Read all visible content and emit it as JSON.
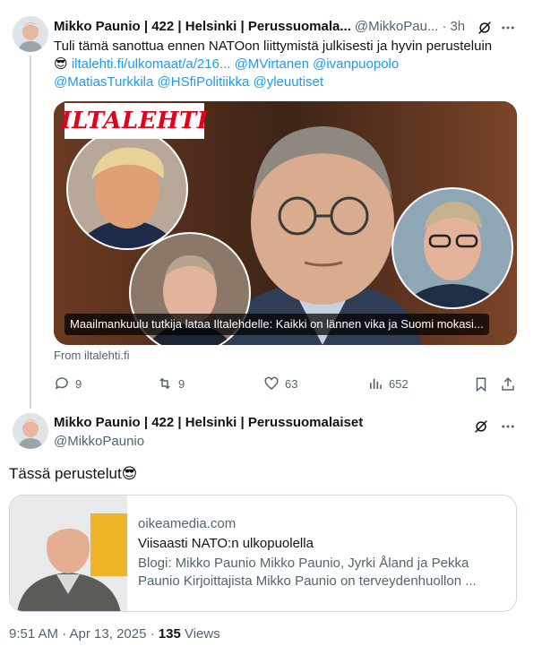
{
  "tweet1": {
    "name": "Mikko Paunio | 422 | Helsinki | Perussuomala...",
    "handle": "@MikkoPau...",
    "dot": "·",
    "time": "3h",
    "text_plain": "Tuli tämä sanottua ennen NATOon liittymistä julkisesti ja hyvin perusteluin",
    "emoji": "😎",
    "link": "iltalehti.fi/ulkomaat/a/216...",
    "mention1": "@MVirtanen",
    "mention2": "@ivanpuopolo",
    "mention3": "@MatiasTurkkila",
    "mention4": "@HSfiPolitiikka",
    "mention5": "@yleuutiset",
    "media": {
      "logo_text": "ILTALEHTI",
      "caption": "Maailmankuulu tutkija lataa Iltalehdelle: Kaikki on lännen vika ja Suomi mokasi..."
    },
    "from": "From iltalehti.fi",
    "actions": {
      "replies": "9",
      "reposts": "9",
      "likes": "63",
      "views": "652"
    },
    "icons": {
      "grok": "grok-icon",
      "more": "more-icon",
      "reply": "reply-icon",
      "repost": "repost-icon",
      "like": "heart-icon",
      "views": "views-icon",
      "bookmark": "bookmark-icon",
      "share": "share-icon"
    }
  },
  "tweet2": {
    "name": "Mikko Paunio | 422 | Helsinki | Perussuomalaiset",
    "handle": "@MikkoPaunio",
    "text": "Tässä perustelut😎",
    "card": {
      "domain": "oikeamedia.com",
      "title": "Viisaasti NATO:n ulkopuolella",
      "description": "Blogi: Mikko Paunio Mikko Paunio, Jyrki Åland ja Pekka Paunio Kirjoittajista Mikko Paunio on terveydenhuollon ..."
    },
    "time": "9:51 AM · Apr 13, 2025 · ",
    "views_count": "135",
    "views_label": " Views"
  },
  "colors": {
    "link": "#1d9bf0",
    "muted": "#536471",
    "text": "#0f1419",
    "border": "#cfd9de",
    "brand_red": "#e2001a"
  }
}
